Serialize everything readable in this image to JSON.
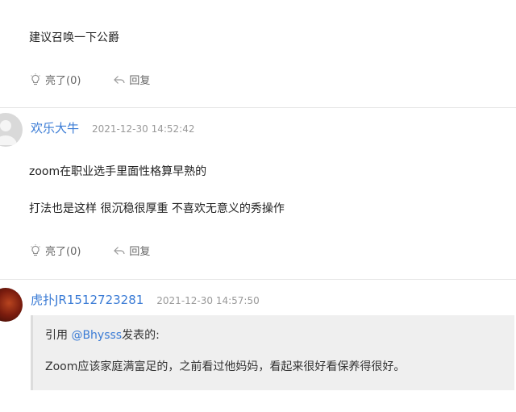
{
  "comments": [
    {
      "lines": [
        "建议召唤一下公爵"
      ],
      "like_label": "亮了(0)",
      "reply_label": "回复"
    },
    {
      "username": "欢乐大牛",
      "time": "2021-12-30 14:52:42",
      "lines": [
        "zoom在职业选手里面性格算早熟的",
        "打法也是这样 很沉稳很厚重 不喜欢无意义的秀操作"
      ],
      "like_label": "亮了(0)",
      "reply_label": "回复"
    },
    {
      "username": "虎扑JR1512723281",
      "time": "2021-12-30 14:57:50",
      "quote": {
        "prefix": "引用 ",
        "user": "@Bhysss",
        "suffix": "发表的:",
        "text": "Zoom应该家庭满富足的，之前看过他妈妈，看起来很好看保养得很好。"
      }
    }
  ],
  "icons": {
    "like": "lightbulb-icon",
    "reply": "reply-arrow-icon",
    "avatar_default": "user-avatar-icon"
  },
  "colors": {
    "username": "#3a7bd5",
    "divider": "#e6e6e6",
    "quote_bg": "#efefef"
  }
}
